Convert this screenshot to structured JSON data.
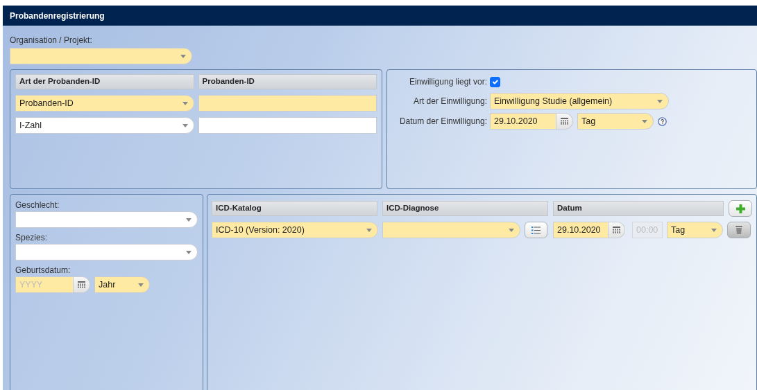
{
  "title": "Probandenregistrierung",
  "organisation": {
    "label": "Organisation / Projekt:",
    "required": true
  },
  "id_panel": {
    "columns": [
      "Art der Probanden-ID",
      "Probanden-ID"
    ],
    "rows": [
      {
        "type": {
          "value": "Probanden-ID",
          "required": true
        },
        "id": {
          "required": true
        }
      },
      {
        "type": {
          "value": "I-Zahl",
          "required": false
        },
        "id": {
          "required": false
        }
      }
    ]
  },
  "consent": {
    "present": {
      "label": "Einwilligung liegt vor:",
      "checked": true
    },
    "type": {
      "label": "Art der Einwilligung:",
      "value": "Einwilligung Studie (allgemein)",
      "required": true
    },
    "date": {
      "label": "Datum der Einwilligung:",
      "value": "29.10.2020",
      "unit": "Tag",
      "required": true
    }
  },
  "demographics": [
    {
      "kind": "select",
      "label": "Geschlecht:",
      "required": false
    },
    {
      "kind": "select",
      "label": "Spezies:",
      "required": false
    },
    {
      "kind": "date",
      "label": "Geburtsdatum:",
      "placeholder": "YYYY",
      "unit": "Jahr",
      "required": true
    }
  ],
  "icd": {
    "columns": [
      "ICD-Katalog",
      "ICD-Diagnose",
      "Datum"
    ],
    "rows": [
      {
        "catalog": "ICD-10 (Version: 2020)",
        "date": "29.10.2020",
        "time": {
          "placeholder": "00:00",
          "disabled": true
        },
        "unit": "Tag",
        "required": true
      }
    ]
  }
}
